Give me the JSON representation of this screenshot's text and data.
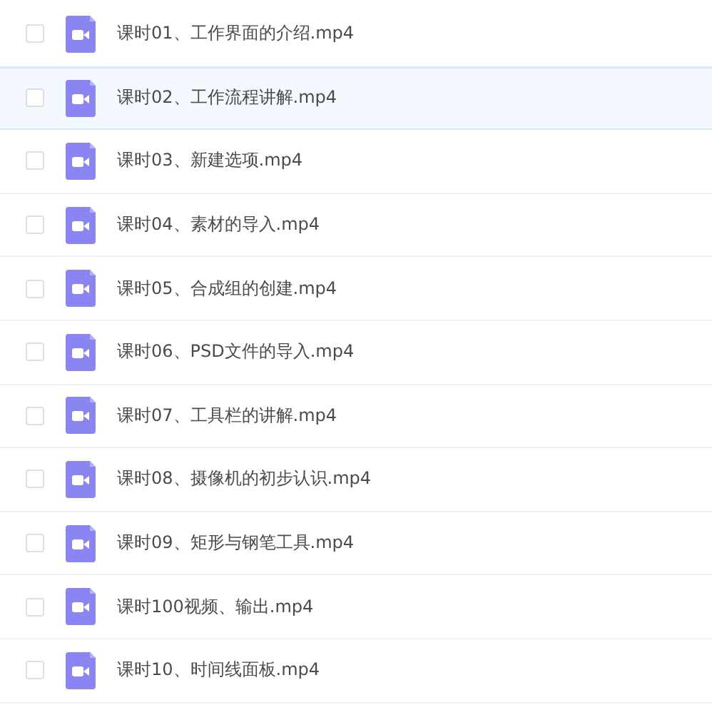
{
  "files": [
    {
      "name": "课时01、工作界面的介绍.mp4",
      "checked": false,
      "selected": false
    },
    {
      "name": "课时02、工作流程讲解.mp4",
      "checked": false,
      "selected": true
    },
    {
      "name": "课时03、新建选项.mp4",
      "checked": false,
      "selected": false
    },
    {
      "name": "课时04、素材的导入.mp4",
      "checked": false,
      "selected": false
    },
    {
      "name": "课时05、合成组的创建.mp4",
      "checked": false,
      "selected": false
    },
    {
      "name": "课时06、PSD文件的导入.mp4",
      "checked": false,
      "selected": false
    },
    {
      "name": "课时07、工具栏的讲解.mp4",
      "checked": false,
      "selected": false
    },
    {
      "name": "课时08、摄像机的初步认识.mp4",
      "checked": false,
      "selected": false
    },
    {
      "name": "课时09、矩形与钢笔工具.mp4",
      "checked": false,
      "selected": false
    },
    {
      "name": "课时100视频、输出.mp4",
      "checked": false,
      "selected": false
    },
    {
      "name": "课时10、时间线面板.mp4",
      "checked": false,
      "selected": false
    }
  ]
}
